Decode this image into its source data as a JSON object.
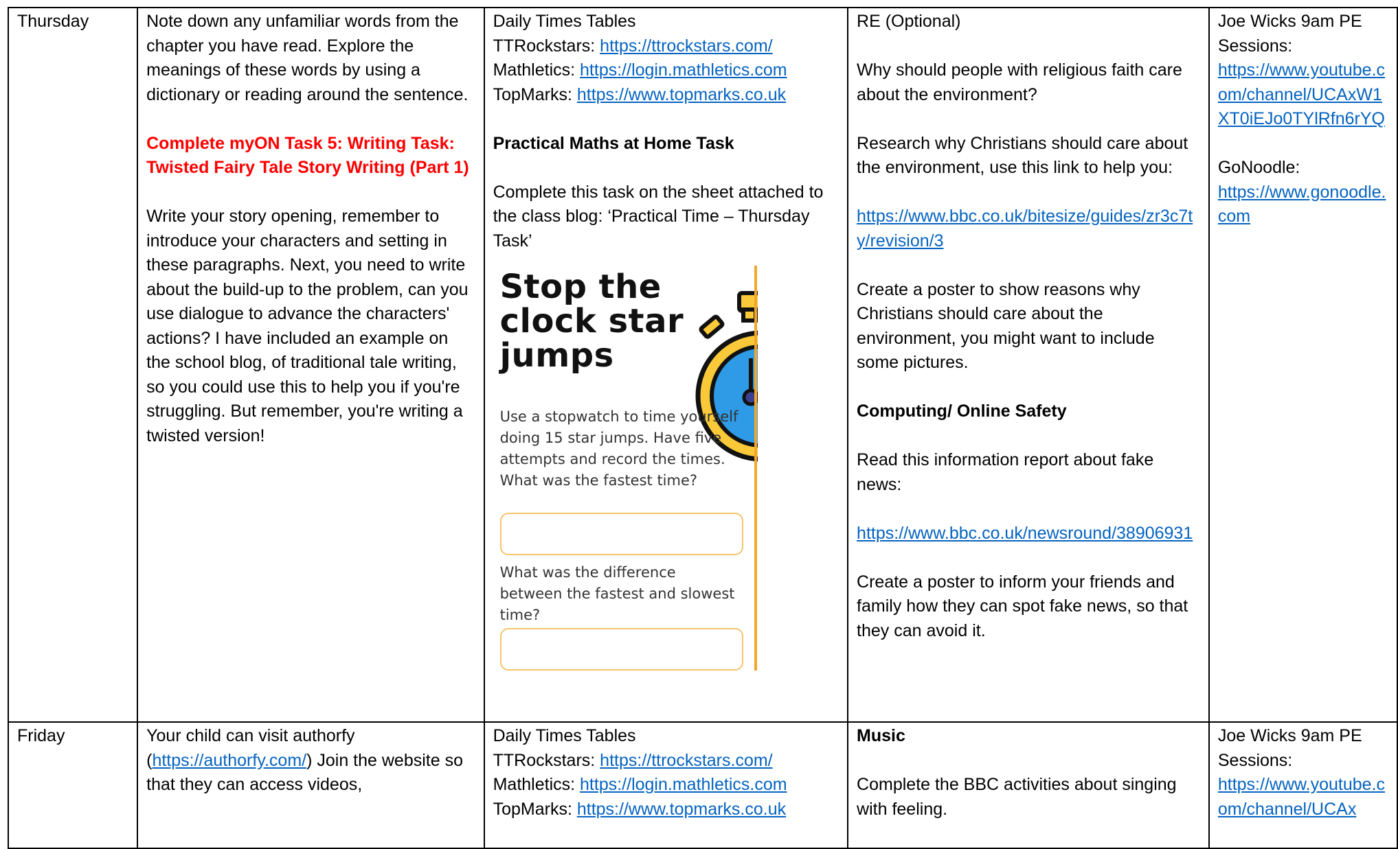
{
  "thursday": {
    "day": "Thursday",
    "literacy": {
      "p1": "Note down any unfamiliar words from the chapter you have read. Explore the meanings of these words by using a dictionary or reading around the sentence.",
      "task": "Complete myON Task 5: Writing Task: Twisted Fairy Tale Story Writing (Part 1)",
      "p2": "Write your story opening, remember to introduce your characters and setting in these paragraphs. Next, you need to write about the build-up to the problem, can you use dialogue to advance the characters' actions? I have included an example on the school blog, of traditional tale writing, so you could use this to help you if you're struggling. But remember, you're writing a twisted version!"
    },
    "maths": {
      "heading": "Daily Times Tables",
      "ttr_label": "TTRockstars: ",
      "ttr_link": "https://ttrockstars.com/",
      "math_label": "Mathletics: ",
      "math_link": "https://login.mathletics.com",
      "top_label": "TopMarks: ",
      "top_link": "https://www.topmarks.co.uk",
      "practical_heading": "Practical Maths at Home Task",
      "practical_text": "Complete this task on the sheet attached to the class blog: ‘Practical Time – Thursday Task’",
      "sheet": {
        "title_line1": "Stop the",
        "title_line2": "clock star",
        "title_line3": "jumps",
        "body": "Use a stopwatch to time yourself doing 15 star jumps. Have five attempts and record the times. What was the fastest time?",
        "q2": "What was the difference between the fastest and slowest time?"
      }
    },
    "re": {
      "heading": "RE (Optional)",
      "question": "Why should people with religious faith care about the environment?",
      "research": "Research why Christians should care about the environment, use this link to help you:",
      "link": "https://www.bbc.co.uk/bitesize/guides/zr3c7ty/revision/3",
      "poster": "Create a poster to show reasons why Christians should care about the environment, you might want to include some pictures.",
      "computing_heading": "Computing/ Online Safety",
      "report": "Read this information report about fake news:",
      "news_link": "https://www.bbc.co.uk/newsround/38906931",
      "poster2": "Create a poster to inform your friends and family how they can spot fake news, so that they can avoid it."
    },
    "pe": {
      "heading": "Joe Wicks 9am PE Sessions:",
      "youtube_link": "https://www.youtube.com/channel/UCAxW1XT0iEJo0TYlRfn6rYQ",
      "gonoodle_label": "GoNoodle:",
      "gonoodle_link": "https://www.gonoodle.com"
    }
  },
  "friday": {
    "day": "Friday",
    "literacy": {
      "prefix": "Your child can visit authorfy (",
      "link": "https://authorfy.com/",
      "suffix": ") Join the website so that they can access videos,"
    },
    "maths": {
      "heading": "Daily Times Tables",
      "ttr_label": "TTRockstars: ",
      "ttr_link": "https://ttrockstars.com/",
      "math_label": "Mathletics: ",
      "math_link": "https://login.mathletics.com",
      "top_label": "TopMarks: ",
      "top_link": "https://www.topmarks.co.uk"
    },
    "music": {
      "heading": "Music",
      "text": "Complete the BBC activities about singing with feeling."
    },
    "pe": {
      "heading": "Joe Wicks 9am PE Sessions:",
      "youtube_link": "https://www.youtube.com/channel/UCAx"
    }
  },
  "colors": {
    "link": "#0563c1",
    "task_red": "#ff0000",
    "sheet_accent": "#f4a62a"
  }
}
